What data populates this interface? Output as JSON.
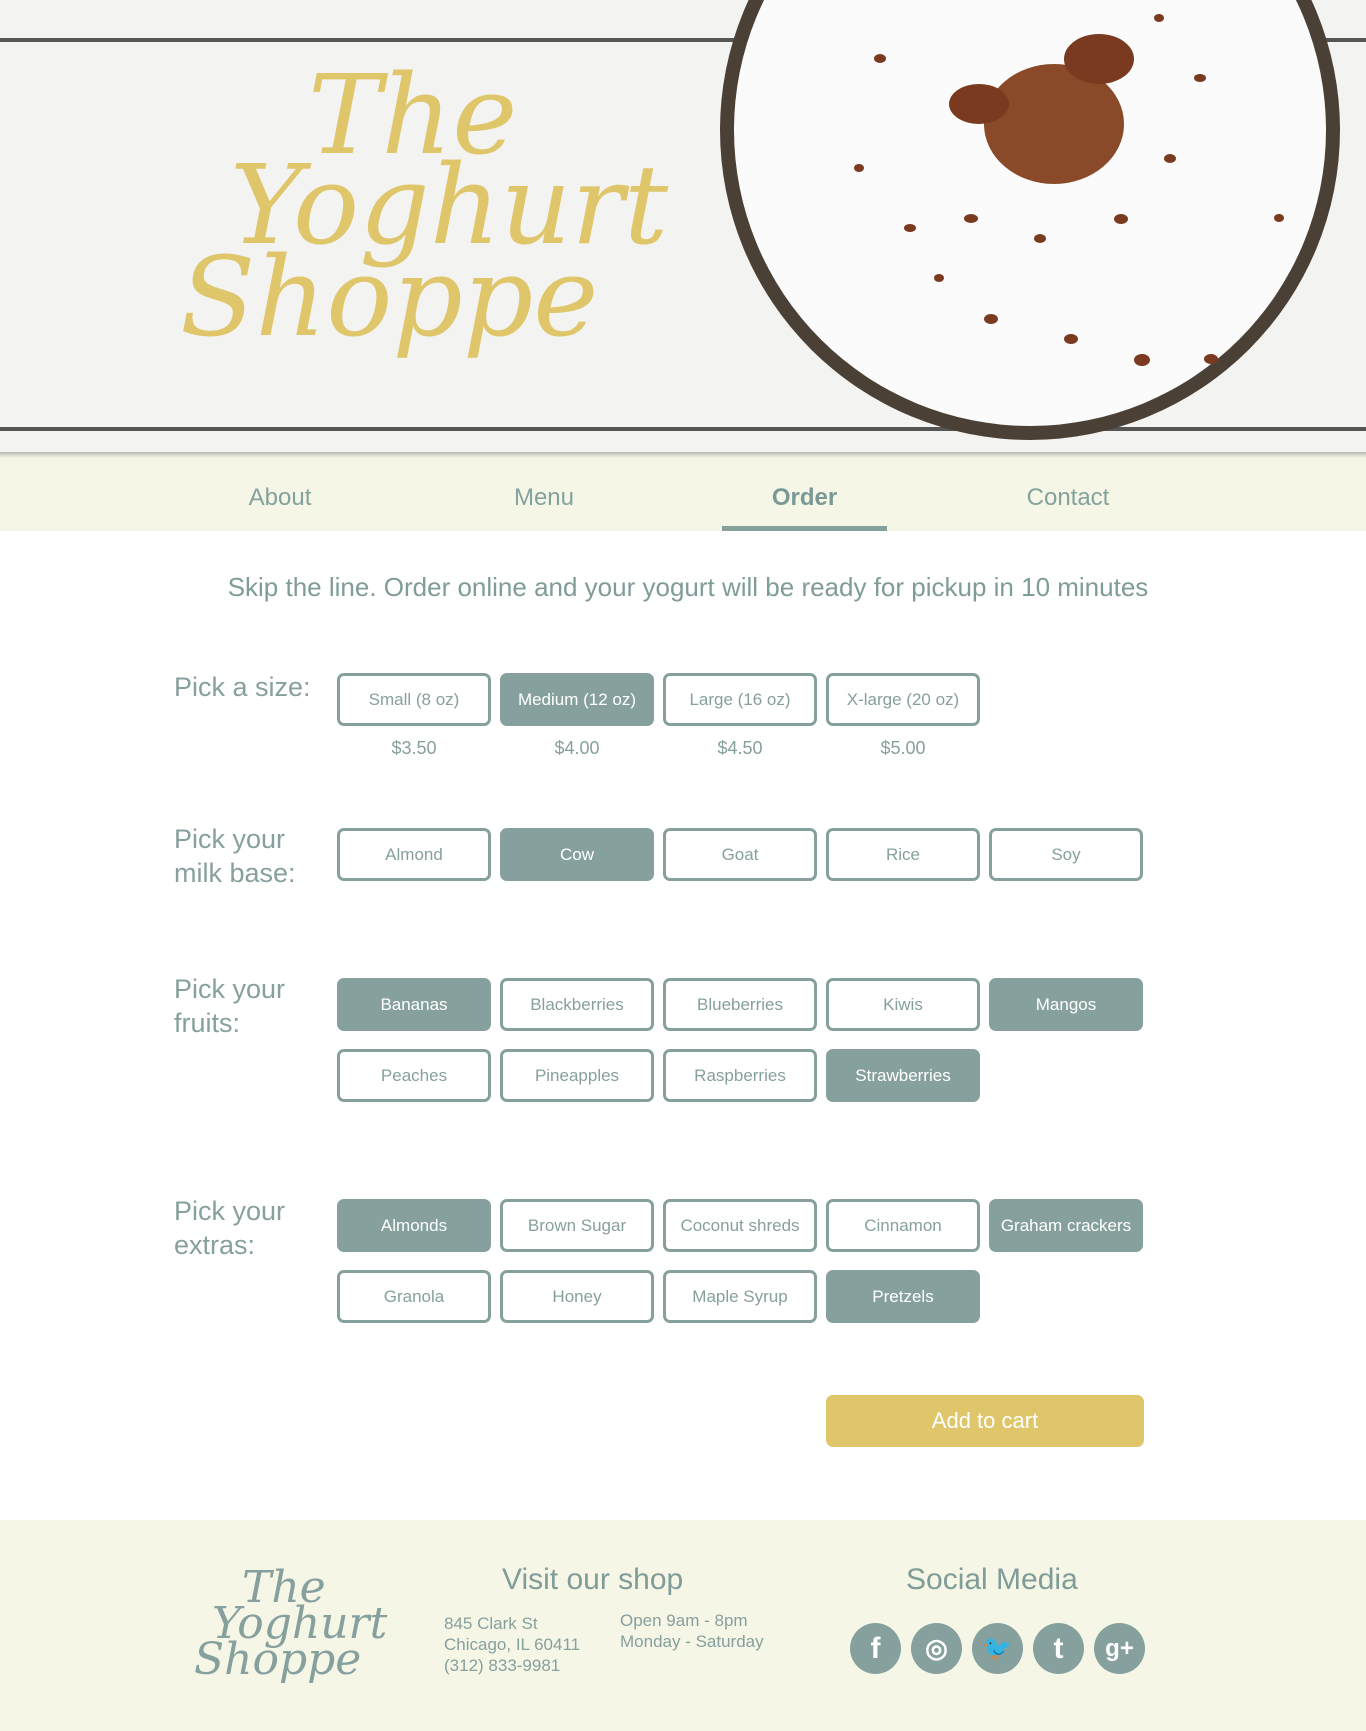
{
  "brand": {
    "line1": "The",
    "line2": "Yoghurt",
    "line3": "Shoppe"
  },
  "nav": {
    "items": [
      {
        "label": "About"
      },
      {
        "label": "Menu"
      },
      {
        "label": "Order",
        "active": true
      },
      {
        "label": "Contact"
      }
    ]
  },
  "intro": "Skip the line. Order online and your yogurt will be ready for pickup in 10 minutes",
  "size": {
    "label": "Pick a size:",
    "options": [
      {
        "label": "Small (8 oz)",
        "price": "$3.50",
        "selected": false
      },
      {
        "label": "Medium (12 oz)",
        "price": "$4.00",
        "selected": true
      },
      {
        "label": "Large (16 oz)",
        "price": "$4.50",
        "selected": false
      },
      {
        "label": "X-large (20 oz)",
        "price": "$5.00",
        "selected": false
      }
    ]
  },
  "milk": {
    "label_line1": "Pick your",
    "label_line2": "milk base:",
    "options": [
      {
        "label": "Almond",
        "selected": false
      },
      {
        "label": "Cow",
        "selected": true
      },
      {
        "label": "Goat",
        "selected": false
      },
      {
        "label": "Rice",
        "selected": false
      },
      {
        "label": "Soy",
        "selected": false
      }
    ]
  },
  "fruits": {
    "label_line1": "Pick your",
    "label_line2": "fruits:",
    "options": [
      {
        "label": "Bananas",
        "selected": true
      },
      {
        "label": "Blackberries",
        "selected": false
      },
      {
        "label": "Blueberries",
        "selected": false
      },
      {
        "label": "Kiwis",
        "selected": false
      },
      {
        "label": "Mangos",
        "selected": true
      },
      {
        "label": "Peaches",
        "selected": false
      },
      {
        "label": "Pineapples",
        "selected": false
      },
      {
        "label": "Raspberries",
        "selected": false
      },
      {
        "label": "Strawberries",
        "selected": true
      }
    ]
  },
  "extras": {
    "label_line1": "Pick your",
    "label_line2": "extras:",
    "options": [
      {
        "label": "Almonds",
        "selected": true
      },
      {
        "label": "Brown Sugar",
        "selected": false
      },
      {
        "label": "Coconut shreds",
        "selected": false
      },
      {
        "label": "Cinnamon",
        "selected": false
      },
      {
        "label": "Graham crackers",
        "selected": true
      },
      {
        "label": "Granola",
        "selected": false
      },
      {
        "label": "Honey",
        "selected": false
      },
      {
        "label": "Maple Syrup",
        "selected": false
      },
      {
        "label": "Pretzels",
        "selected": true
      }
    ]
  },
  "cart": {
    "label": "Add to cart"
  },
  "footer": {
    "visit_heading": "Visit our shop",
    "address_line1": "845 Clark St",
    "address_line2": "Chicago, IL 60411",
    "phone": "(312) 833-9981",
    "hours_line1": "Open 9am - 8pm",
    "hours_line2": "Monday - Saturday",
    "social_heading": "Social Media",
    "social": [
      {
        "icon": "facebook-icon",
        "glyph": "f"
      },
      {
        "icon": "instagram-icon",
        "glyph": "◎"
      },
      {
        "icon": "twitter-icon",
        "glyph": "🐦"
      },
      {
        "icon": "tumblr-icon",
        "glyph": "t"
      },
      {
        "icon": "google-plus-icon",
        "glyph": "g+"
      }
    ]
  },
  "colors": {
    "accent": "#86a09e",
    "brand_yellow": "#e0c66a",
    "nav_bg": "#f6f6e6"
  }
}
